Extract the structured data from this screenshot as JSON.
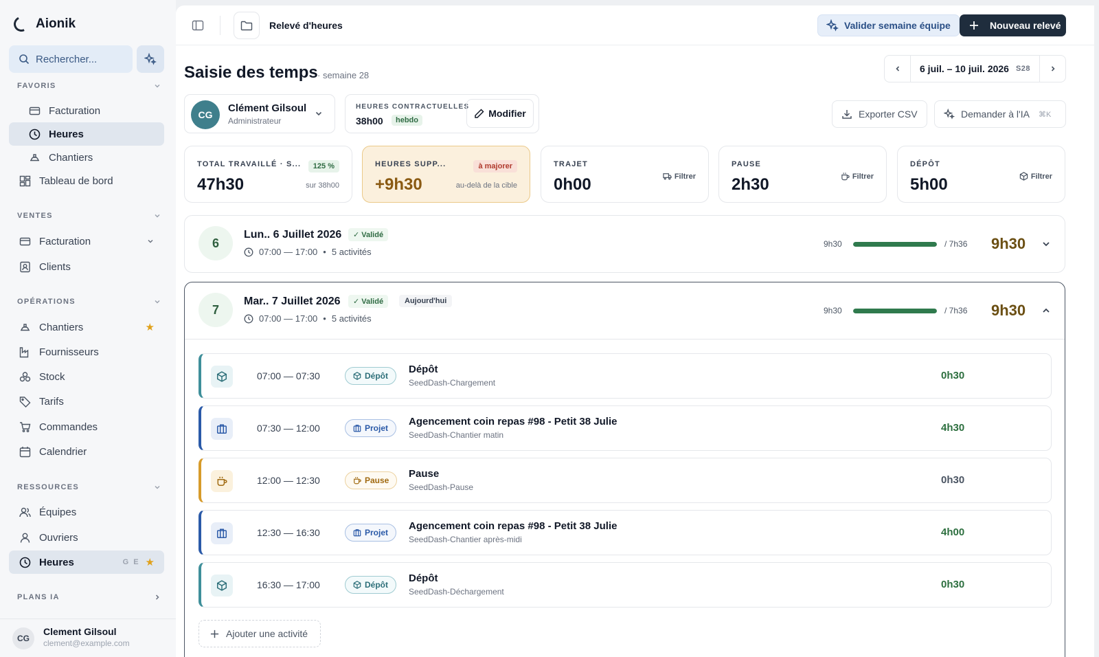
{
  "app": {
    "name": "Aionik"
  },
  "search": {
    "placeholder": "Rechercher..."
  },
  "sidebar": {
    "favoris_label": "FAVORIS",
    "favoris": [
      {
        "label": "Facturation"
      },
      {
        "label": "Heures"
      },
      {
        "label": "Chantiers"
      }
    ],
    "dashboard": "Tableau de bord",
    "ventes_label": "VENTES",
    "ventes": [
      {
        "label": "Facturation"
      },
      {
        "label": "Clients"
      }
    ],
    "operations_label": "OPÉRATIONS",
    "operations": [
      {
        "label": "Chantiers"
      },
      {
        "label": "Fournisseurs"
      },
      {
        "label": "Stock"
      },
      {
        "label": "Tarifs"
      },
      {
        "label": "Commandes"
      },
      {
        "label": "Calendrier"
      }
    ],
    "ressources_label": "RESSOURCES",
    "ressources": [
      {
        "label": "Équipes"
      },
      {
        "label": "Ouvriers"
      },
      {
        "label": "Heures",
        "shortcut": "G E"
      }
    ],
    "plans_label": "PLANS IA",
    "user": {
      "name": "Clement Gilsoul",
      "email": "clement@example.com",
      "initials": "CG"
    }
  },
  "topbar": {
    "breadcrumb": "Relevé d'heures",
    "validate_label": "Valider semaine équipe",
    "new_label": "Nouveau relevé"
  },
  "page": {
    "title": "Saisie des temps",
    "subtitle": "· semaine 28",
    "week_range": "6 juil. – 10 juil. 2026",
    "week_code": "S28"
  },
  "employee": {
    "initials": "CG",
    "name": "Clément Gilsoul",
    "role": "Administrateur"
  },
  "contract": {
    "label": "HEURES CONTRACTUELLES",
    "value": "38h00",
    "tag": "hebdo",
    "edit_label": "Modifier"
  },
  "actions": {
    "export_label": "Exporter CSV",
    "ask_ai_label": "Demander à l'IA",
    "ask_ai_shortcut": "⌘K"
  },
  "stats": {
    "total": {
      "label": "TOTAL TRAVAILLÉ · S...",
      "value": "47h30",
      "pill": "125 %",
      "note": "sur 38h00"
    },
    "overtime": {
      "label": "HEURES SUPP...",
      "value": "+9h30",
      "pill": "à majorer",
      "note": "au-delà de la cible"
    },
    "trajet": {
      "label": "TRAJET",
      "value": "0h00",
      "filter": "Filtrer"
    },
    "pause": {
      "label": "PAUSE",
      "value": "2h30",
      "filter": "Filtrer"
    },
    "depot": {
      "label": "DÉPÔT",
      "value": "5h00",
      "filter": "Filtrer"
    }
  },
  "days": [
    {
      "num": "6",
      "title": "Lun.. 6 Juillet 2026",
      "status": "Validé",
      "time": "07:00 — 17:00",
      "activities": "5 activités",
      "worked": "9h30",
      "target": "/ 7h36",
      "total": "9h30",
      "progress": 1.0
    },
    {
      "num": "7",
      "title": "Mar.. 7 Juillet 2026",
      "status": "Validé",
      "today": "Aujourd'hui",
      "time": "07:00 — 17:00",
      "activities": "5 activités",
      "worked": "9h30",
      "target": "/ 7h36",
      "total": "9h30",
      "progress": 1.0,
      "entries": [
        {
          "time": "07:00 — 07:30",
          "type": "Dépôt",
          "title": "Dépôt",
          "sub": "SeedDash-Chargement",
          "duration": "0h30"
        },
        {
          "time": "07:30 — 12:00",
          "type": "Projet",
          "title": "Agencement coin repas #98 - Petit 38 Julie",
          "sub": "SeedDash-Chantier matin",
          "duration": "4h30"
        },
        {
          "time": "12:00 — 12:30",
          "type": "Pause",
          "title": "Pause",
          "sub": "SeedDash-Pause",
          "duration": "0h30"
        },
        {
          "time": "12:30 — 16:30",
          "type": "Projet",
          "title": "Agencement coin repas #98 - Petit 38 Julie",
          "sub": "SeedDash-Chantier après-midi",
          "duration": "4h00"
        },
        {
          "time": "16:30 — 17:00",
          "type": "Dépôt",
          "title": "Dépôt",
          "sub": "SeedDash-Déchargement",
          "duration": "0h30"
        }
      ],
      "add_label": "Ajouter une activité"
    }
  ],
  "colors": {
    "depot": "#3f8f9a",
    "projet": "#2b5aa8",
    "pause": "#d79b2b",
    "accent": "#2f7a4d",
    "warning_bg": "#fbf0dd"
  }
}
